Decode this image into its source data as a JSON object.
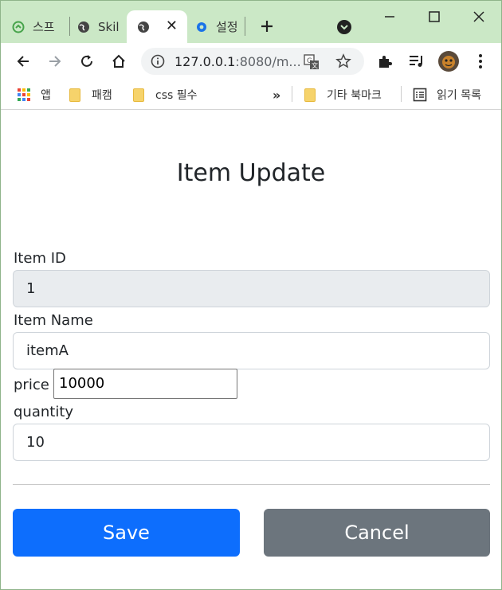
{
  "browser": {
    "tabs": [
      {
        "label": "스프",
        "icon": "spring-icon"
      },
      {
        "label": "Skil",
        "icon": "globe-icon"
      },
      {
        "label": "",
        "icon": "globe-icon",
        "active": true
      },
      {
        "label": "설정",
        "icon": "gear-icon"
      }
    ],
    "url_host": "127.0.0.1",
    "url_rest": ":8080/m...",
    "bookmarks": {
      "apps": "앱",
      "b1": "패캠",
      "b2": "css 필수",
      "more": "»",
      "other": "기타 북마크",
      "reading": "읽기 목록"
    }
  },
  "page": {
    "title": "Item Update",
    "fields": {
      "item_id_label": "Item ID",
      "item_id_value": "1",
      "item_name_label": "Item Name",
      "item_name_value": "itemA",
      "price_label": "price",
      "price_value": "10000",
      "quantity_label": "quantity",
      "quantity_value": "10"
    },
    "buttons": {
      "save": "Save",
      "cancel": "Cancel"
    }
  },
  "colors": {
    "primary": "#0d6efd",
    "secondary": "#6c757d",
    "tabstrip": "#cbe8c6"
  }
}
